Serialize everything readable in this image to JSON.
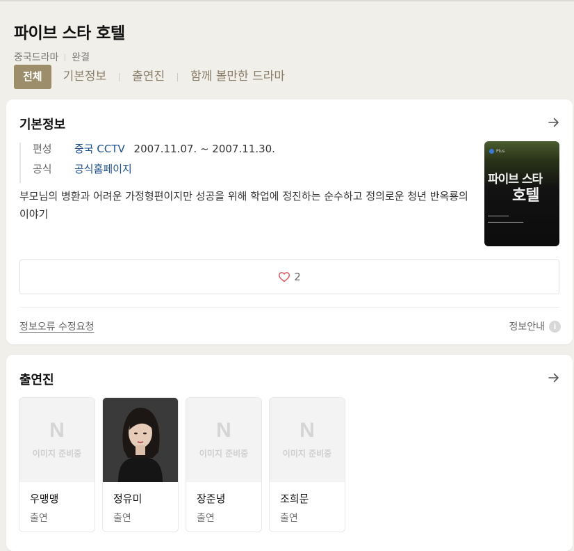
{
  "header": {
    "title": "파이브 스타 호텔",
    "genre": "중국드라마",
    "status": "완결"
  },
  "tabs": [
    {
      "label": "전체",
      "active": true
    },
    {
      "label": "기본정보",
      "active": false
    },
    {
      "label": "출연진",
      "active": false
    },
    {
      "label": "함께 볼만한 드라마",
      "active": false
    }
  ],
  "basic_info": {
    "title": "기본정보",
    "rows": {
      "broadcast_label": "편성",
      "broadcast_channel": "중국 CCTV",
      "broadcast_period": "2007.11.07. ~ 2007.11.30.",
      "official_label": "공식",
      "official_link": "공식홈페이지"
    },
    "description": "부모님의 병환과 어려운 가정형편이지만 성공을 위해 학업에 정진하는 순수하고 정의로운 청년 반옥룡의 이야기",
    "poster": {
      "title_line1": "파이브 스타",
      "title_line2": "호텔",
      "badge": "Plus"
    },
    "like_count": "2",
    "report_link": "정보오류 수정요청",
    "info_guide": "정보안내"
  },
  "cast": {
    "title": "출연진",
    "placeholder_text": "이미지 준비중",
    "placeholder_logo": "N",
    "members": [
      {
        "name": "우맹맹",
        "role": "출연",
        "has_photo": false
      },
      {
        "name": "정유미",
        "role": "출연",
        "has_photo": true
      },
      {
        "name": "장준녕",
        "role": "출연",
        "has_photo": false
      },
      {
        "name": "조희문",
        "role": "출연",
        "has_photo": false
      }
    ]
  },
  "colors": {
    "accent": "#9c8e6b",
    "link": "#1d4f8c",
    "background": "#f1efea",
    "heart": "#e0505a"
  }
}
